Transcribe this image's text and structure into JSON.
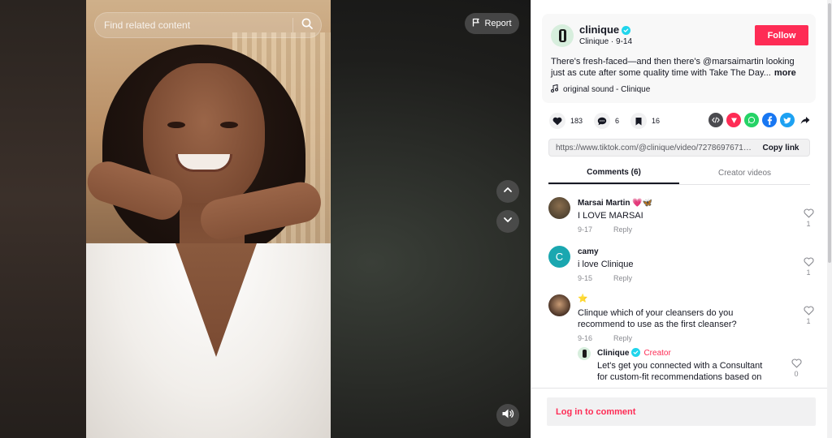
{
  "search": {
    "placeholder": "Find related content"
  },
  "video": {
    "report_label": "Report"
  },
  "author": {
    "name": "clinique",
    "meta": "Clinique · 9-14",
    "follow_label": "Follow",
    "description": "There's fresh-faced—and then there's @marsaimartin looking just as cute after some quality time with Take The Day...",
    "more_label": "more",
    "sound": "original sound - Clinique"
  },
  "stats": {
    "likes": "183",
    "comments": "6",
    "saves": "16"
  },
  "share": {
    "url": "https://www.tiktok.com/@clinique/video/72786976714...",
    "copy_label": "Copy link",
    "icons": [
      "embed-icon",
      "send-icon",
      "whatsapp-icon",
      "facebook-icon",
      "twitter-icon",
      "share-icon"
    ]
  },
  "tabs": [
    {
      "label": "Comments (6)",
      "active": true
    },
    {
      "label": "Creator videos",
      "active": false
    }
  ],
  "comments": [
    {
      "user": "Marsai Martin 💗🦋",
      "text": "I LOVE MARSAI",
      "date": "9-17",
      "reply": "Reply",
      "likes": "1"
    },
    {
      "user": "camy",
      "avatar_letter": "C",
      "text": "i love Clinique",
      "date": "9-15",
      "reply": "Reply",
      "likes": "1"
    },
    {
      "user": "⭐",
      "text": "Clinque which of your cleansers do you recommend to use as the first cleanser?",
      "date": "9-16",
      "reply": "Reply",
      "likes": "1"
    }
  ],
  "creator_reply": {
    "user": "Clinique",
    "tag": "Creator",
    "text": "Let's get you connected with a Consultant for custom-fit recommendations based on your",
    "likes": "0"
  },
  "bottom": {
    "login_label": "Log in to comment"
  },
  "colors": {
    "brand": "#fe2c55",
    "verified": "#20d5ec",
    "avatar_camy": "#1aa7b0"
  }
}
